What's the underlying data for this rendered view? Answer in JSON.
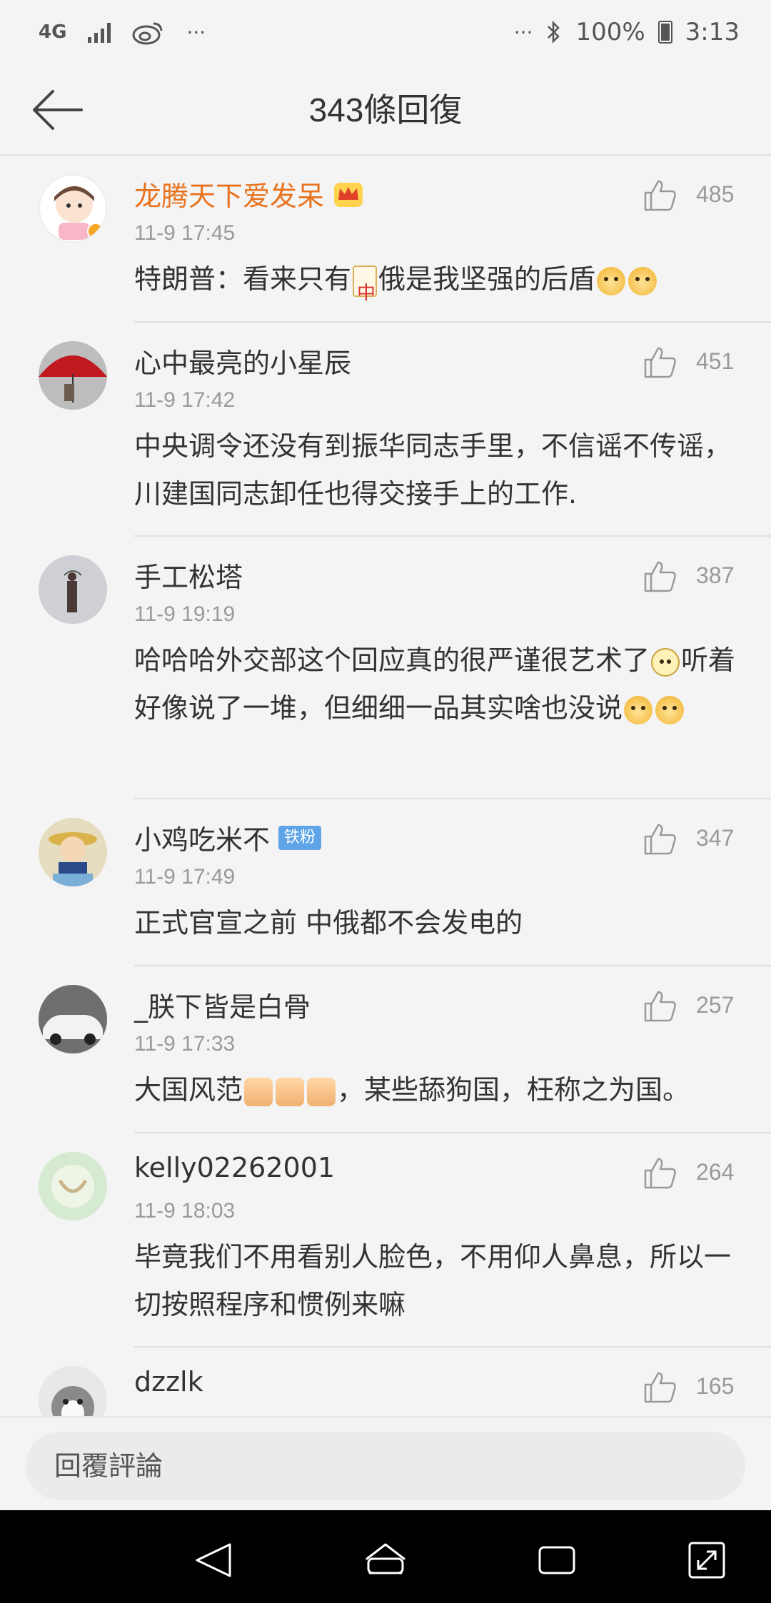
{
  "status_bar": {
    "network": "4G",
    "dots": "···",
    "battery": "100%",
    "time": "3:13"
  },
  "header": {
    "title": "343條回復"
  },
  "comments": [
    {
      "username": "龙腾天下爱发呆",
      "time": "11-9 17:45",
      "text_parts": [
        "特朗普：看来只有",
        "俄是我坚强的后盾"
      ],
      "likes": "485",
      "vip": true
    },
    {
      "username": "心中最亮的小星辰",
      "time": "11-9 17:42",
      "text": "中央调令还没有到振华同志手里，不信谣不传谣，川建国同志卸任也得交接手上的工作.",
      "likes": "451"
    },
    {
      "username": "手工松塔",
      "time": "11-9 19:19",
      "text_parts": [
        "哈哈哈外交部这个回应真的很严谨很艺术了",
        "听着好像说了一堆，但细细一品其实啥也没说"
      ],
      "likes": "387"
    },
    {
      "username": "小鸡吃米不",
      "badge": "铁粉",
      "time": "11-9 17:49",
      "text": "正式官宣之前 中俄都不会发电的",
      "likes": "347"
    },
    {
      "username": "_朕下皆是白骨",
      "time": "11-9 17:33",
      "text_parts": [
        "大国风范",
        "，某些舔狗国，枉称之为国。"
      ],
      "likes": "257"
    },
    {
      "username": "kelly02262001",
      "time": "11-9 18:03",
      "text": "毕竟我们不用看别人脸色，不用仰人鼻息，所以一切按照程序和惯例来嘛",
      "likes": "264"
    },
    {
      "username": "dzzlk",
      "likes": "165"
    }
  ],
  "reply_bar": {
    "placeholder": "回覆評論"
  },
  "icons": {
    "back": "back-arrow-icon",
    "like": "thumbs-up-icon",
    "nav_back": "nav-back-icon",
    "nav_home": "nav-home-icon",
    "nav_recent": "nav-recents-icon",
    "nav_expand": "nav-expand-icon"
  },
  "colors": {
    "vip_name": "#e8731f",
    "fan_badge": "#5ea4e6"
  }
}
